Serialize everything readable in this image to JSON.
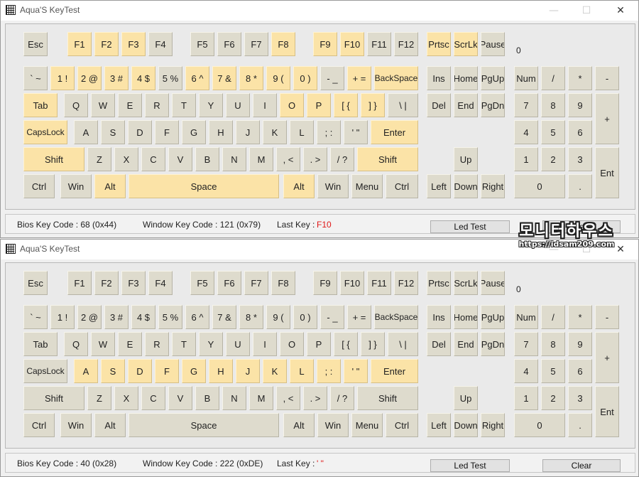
{
  "windows": [
    {
      "title": "Aqua'S KeyTest",
      "code_display": "0",
      "bios_key_code": "Bios Key Code : 68 (0x44)",
      "window_key_code": "Window Key Code : 121 (0x79)",
      "last_key_label": "Last Key :",
      "last_key_value": "F10",
      "led_test_label": "Led Test",
      "clear_label": "Clear",
      "highlighted_keys": [
        "F1",
        "F2",
        "F3",
        "F8",
        "F9",
        "F10",
        "1 !",
        "2 @",
        "3 #",
        "4 $",
        "6 ^",
        "7 &",
        "8 *",
        "9 (",
        "0 )",
        "+ =",
        "BackSpace",
        "Tab",
        "O",
        "P",
        "[ {",
        "] }",
        "CapsLock",
        "Enter",
        "Shift",
        "Alt",
        "Space",
        "Prtsc",
        "ScrLk"
      ]
    },
    {
      "title": "Aqua'S KeyTest",
      "code_display": "0",
      "bios_key_code": "Bios Key Code : 40 (0x28)",
      "window_key_code": "Window Key Code : 222 (0xDE)",
      "last_key_label": "Last Key :",
      "last_key_value": "' \"",
      "led_test_label": "Led Test",
      "clear_label": "Clear",
      "highlighted_keys": [
        "A",
        "S",
        "D",
        "F",
        "G",
        "H",
        "J",
        "K",
        "L",
        "; :",
        "' \"",
        "Enter"
      ]
    }
  ],
  "titlebar_buttons": {
    "minimize": "—",
    "maximize": "☐",
    "close": "✕"
  },
  "keys": [
    "Esc",
    "F1",
    "F2",
    "F3",
    "F4",
    "F5",
    "F6",
    "F7",
    "F8",
    "F9",
    "F10",
    "F11",
    "F12",
    "` ~",
    "1 !",
    "2 @",
    "3 #",
    "4 $",
    "5 %",
    "6 ^",
    "7 &",
    "8 *",
    "9 (",
    "0 )",
    "- _",
    "+ =",
    "BackSpace",
    "Tab",
    "Q",
    "W",
    "E",
    "R",
    "T",
    "Y",
    "U",
    "I",
    "O",
    "P",
    "[ {",
    "] }",
    "\\ |",
    "CapsLock",
    "A",
    "S",
    "D",
    "F",
    "G",
    "H",
    "J",
    "K",
    "L",
    "; :",
    "' \"",
    "Enter",
    "Shift",
    "Z",
    "X",
    "C",
    "V",
    "B",
    "N",
    "M",
    ", <",
    ". >",
    "/ ?",
    "Shift",
    "Ctrl",
    "Win",
    "Alt",
    "Space",
    "Alt",
    "Win",
    "Menu",
    "Ctrl",
    "Prtsc",
    "ScrLk",
    "Pause",
    "Ins",
    "Home",
    "PgUp",
    "Del",
    "End",
    "PgDn",
    "Up",
    "Left",
    "Down",
    "Right",
    "Num",
    "/",
    "*",
    "-",
    "7",
    "8",
    "9",
    "+",
    "4",
    "5",
    "6",
    "1",
    "2",
    "3",
    "Ent",
    "0",
    "."
  ],
  "watermark": {
    "main": "모니터하우스",
    "url": "https://idsam209.com"
  }
}
